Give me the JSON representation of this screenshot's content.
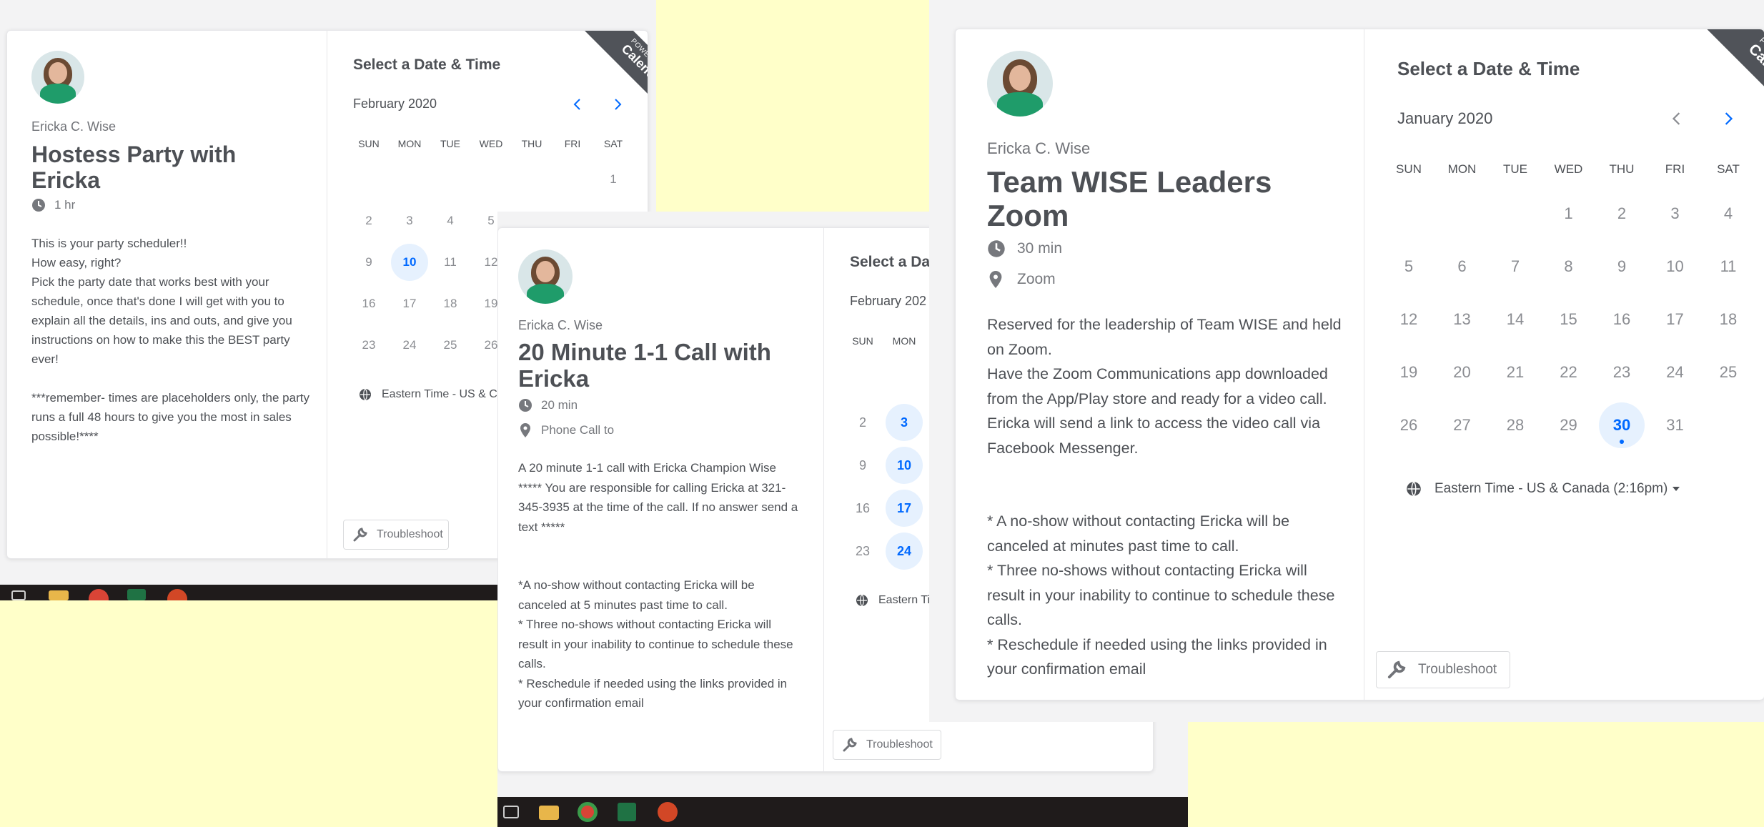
{
  "ribbon": {
    "top": "POWERED BY",
    "brand": "Calendly"
  },
  "shot1": {
    "host": "Ericka C. Wise",
    "title": "Hostess Party with Ericka",
    "duration": "1 hr",
    "description": [
      "This is your party scheduler!!",
      "How easy, right?",
      "Pick the party date that works best with your schedule, once that's done I will get with you to explain all the details, ins and outs, and give you instructions on how to make this the BEST party ever!",
      "",
      "***remember- times are placeholders only, the party runs a full 48 hours to give you the most in sales possible!****"
    ],
    "select_title": "Select a Date & Time",
    "month": "February 2020",
    "weekdays": [
      "SUN",
      "MON",
      "TUE",
      "WED",
      "THU",
      "FRI",
      "SAT"
    ],
    "rows": [
      [
        "",
        "",
        "",
        "",
        "",
        "",
        "1"
      ],
      [
        "2",
        "3",
        "4",
        "5",
        "",
        "",
        ""
      ],
      [
        "9",
        "10",
        "11",
        "12",
        "",
        "",
        ""
      ],
      [
        "16",
        "17",
        "18",
        "19",
        "",
        "",
        ""
      ],
      [
        "23",
        "24",
        "25",
        "26",
        "",
        "",
        ""
      ]
    ],
    "available": [
      "10"
    ],
    "timezone": "Eastern Time - US & Car",
    "troubleshoot": "Troubleshoot"
  },
  "shot2": {
    "host": "Ericka C. Wise",
    "title": "20 Minute 1-1 Call with Ericka",
    "duration": "20 min",
    "location": "Phone Call to",
    "description": [
      "A 20 minute 1-1 call with Ericka Champion Wise",
      "***** You are responsible for calling Ericka at 321-345-3935 at the time of the call. If no answer send a text *****",
      "",
      "",
      "*A no-show without contacting Ericka will be canceled at 5 minutes past time to call.",
      "* Three no-shows without contacting Ericka will result in your inability to continue to schedule these calls.",
      "* Reschedule if needed using the links provided in your confirmation email"
    ],
    "select_title": "Select a Da",
    "month": "February 202",
    "weekdays": [
      "SUN",
      "MON"
    ],
    "rows": [
      [
        "2",
        "3"
      ],
      [
        "9",
        "10"
      ],
      [
        "16",
        "17"
      ],
      [
        "23",
        "24"
      ]
    ],
    "available": [
      "3",
      "10",
      "17",
      "24"
    ],
    "timezone": "Eastern Ti",
    "troubleshoot": "Troubleshoot"
  },
  "shot3": {
    "host": "Ericka C. Wise",
    "title": "Team WISE Leaders Zoom",
    "duration": "30 min",
    "location": "Zoom",
    "description": [
      "Reserved for the leadership of Team WISE and held on Zoom.",
      "Have the Zoom Communications app downloaded from the App/Play store and ready for a video call. Ericka will send a link to access the video call via Facebook Messenger.",
      "",
      "",
      "* A no-show without contacting Ericka will be canceled at minutes past time to call.",
      "*  Three no-shows without contacting Ericka will result in your inability to continue to schedule these calls.",
      "* Reschedule if needed using the links provided in your confirmation email"
    ],
    "select_title": "Select a Date & Time",
    "month": "January 2020",
    "weekdays": [
      "SUN",
      "MON",
      "TUE",
      "WED",
      "THU",
      "FRI",
      "SAT"
    ],
    "rows": [
      [
        "",
        "",
        "",
        "1",
        "2",
        "3",
        "4"
      ],
      [
        "5",
        "6",
        "7",
        "8",
        "9",
        "10",
        "11"
      ],
      [
        "12",
        "13",
        "14",
        "15",
        "16",
        "17",
        "18"
      ],
      [
        "19",
        "20",
        "21",
        "22",
        "23",
        "24",
        "25"
      ],
      [
        "26",
        "27",
        "28",
        "29",
        "30",
        "31",
        ""
      ]
    ],
    "available": [
      "30"
    ],
    "timezone": "Eastern Time - US & Canada (2:16pm)",
    "troubleshoot": "Troubleshoot"
  },
  "colors": {
    "accent": "#0069ff",
    "available_bg": "#e6f1fe",
    "background": "#ffffc9",
    "taskbar": "#1f1b1b"
  },
  "icons": [
    "clock-icon",
    "location-pin-icon",
    "globe-icon",
    "wrench-icon",
    "chevron-left-icon",
    "chevron-right-icon",
    "caret-down-icon"
  ]
}
